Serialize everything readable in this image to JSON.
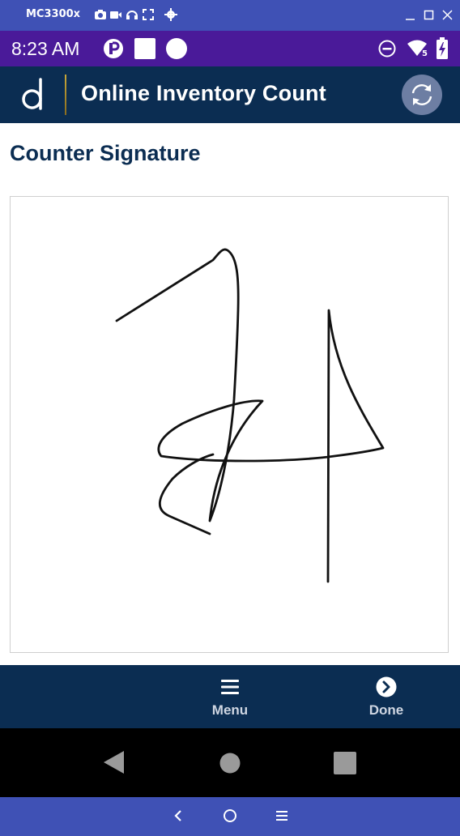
{
  "emulator": {
    "title": "MC3300x",
    "toolbar_icons": [
      "camera-icon",
      "video-icon",
      "headset-icon",
      "fullscreen-icon",
      "settings-icon"
    ],
    "window_controls": [
      "minimize-icon",
      "maximize-icon",
      "close-icon"
    ],
    "bottom_nav": [
      "back-icon",
      "home-icon",
      "menu-icon"
    ]
  },
  "status_bar": {
    "time": "8:23 AM",
    "left_icons": [
      "app-notification-icon",
      "white-square-icon",
      "white-circle-icon"
    ],
    "right_icons": [
      "do-not-disturb-icon",
      "wifi-icon",
      "battery-icon"
    ],
    "wifi_badge": "5"
  },
  "header": {
    "title": "Online Inventory Count",
    "logo_icon": "app-logo-icon",
    "sync_icon": "sync-icon"
  },
  "page": {
    "heading": "Counter Signature"
  },
  "bottom_toolbar": {
    "menu_label": "Menu",
    "done_label": "Done"
  },
  "colors": {
    "emulator_bar": "#3f51b5",
    "status_bar": "#4a1a99",
    "header_bg": "#0b2d52",
    "heading_text": "#0b2d52",
    "nav_bar": "#000000"
  }
}
